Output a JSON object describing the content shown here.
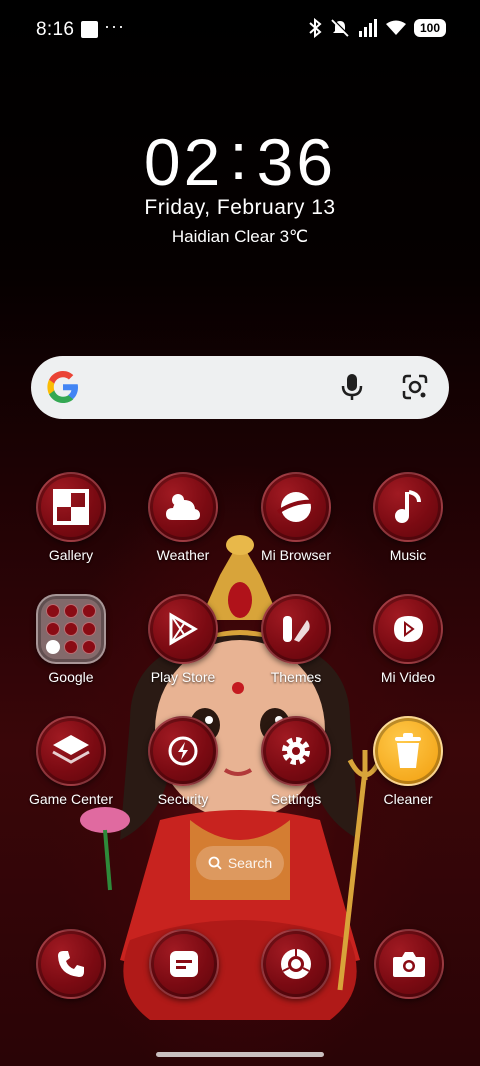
{
  "status_bar": {
    "time": "8:16",
    "overflow": "···",
    "battery": "100"
  },
  "clock": {
    "hours": "02",
    "separator": ":",
    "minutes": "36"
  },
  "date": "Friday,  February  13",
  "weather": "Haidian Clear 3℃",
  "google_search": {
    "logo": "G"
  },
  "apps": [
    {
      "label": "Gallery",
      "icon": "gallery-icon"
    },
    {
      "label": "Weather",
      "icon": "weather-icon"
    },
    {
      "label": "Mi Browser",
      "icon": "browser-icon"
    },
    {
      "label": "Music",
      "icon": "music-icon"
    },
    {
      "label": "Google",
      "icon": "folder-icon"
    },
    {
      "label": "Play Store",
      "icon": "play-store-icon"
    },
    {
      "label": "Themes",
      "icon": "themes-icon"
    },
    {
      "label": "Mi Video",
      "icon": "video-icon"
    },
    {
      "label": "Game Center",
      "icon": "game-center-icon"
    },
    {
      "label": "Security",
      "icon": "security-icon"
    },
    {
      "label": "Settings",
      "icon": "settings-icon"
    },
    {
      "label": "Cleaner",
      "icon": "cleaner-icon"
    }
  ],
  "home_search": {
    "label": "Search"
  },
  "dock": [
    {
      "icon": "phone-icon"
    },
    {
      "icon": "messages-icon"
    },
    {
      "icon": "chrome-icon"
    },
    {
      "icon": "camera-icon"
    }
  ],
  "colors": {
    "accent": "#7a0a12",
    "cleaner": "#f5a91d",
    "search_bg": "#eef0f1"
  }
}
